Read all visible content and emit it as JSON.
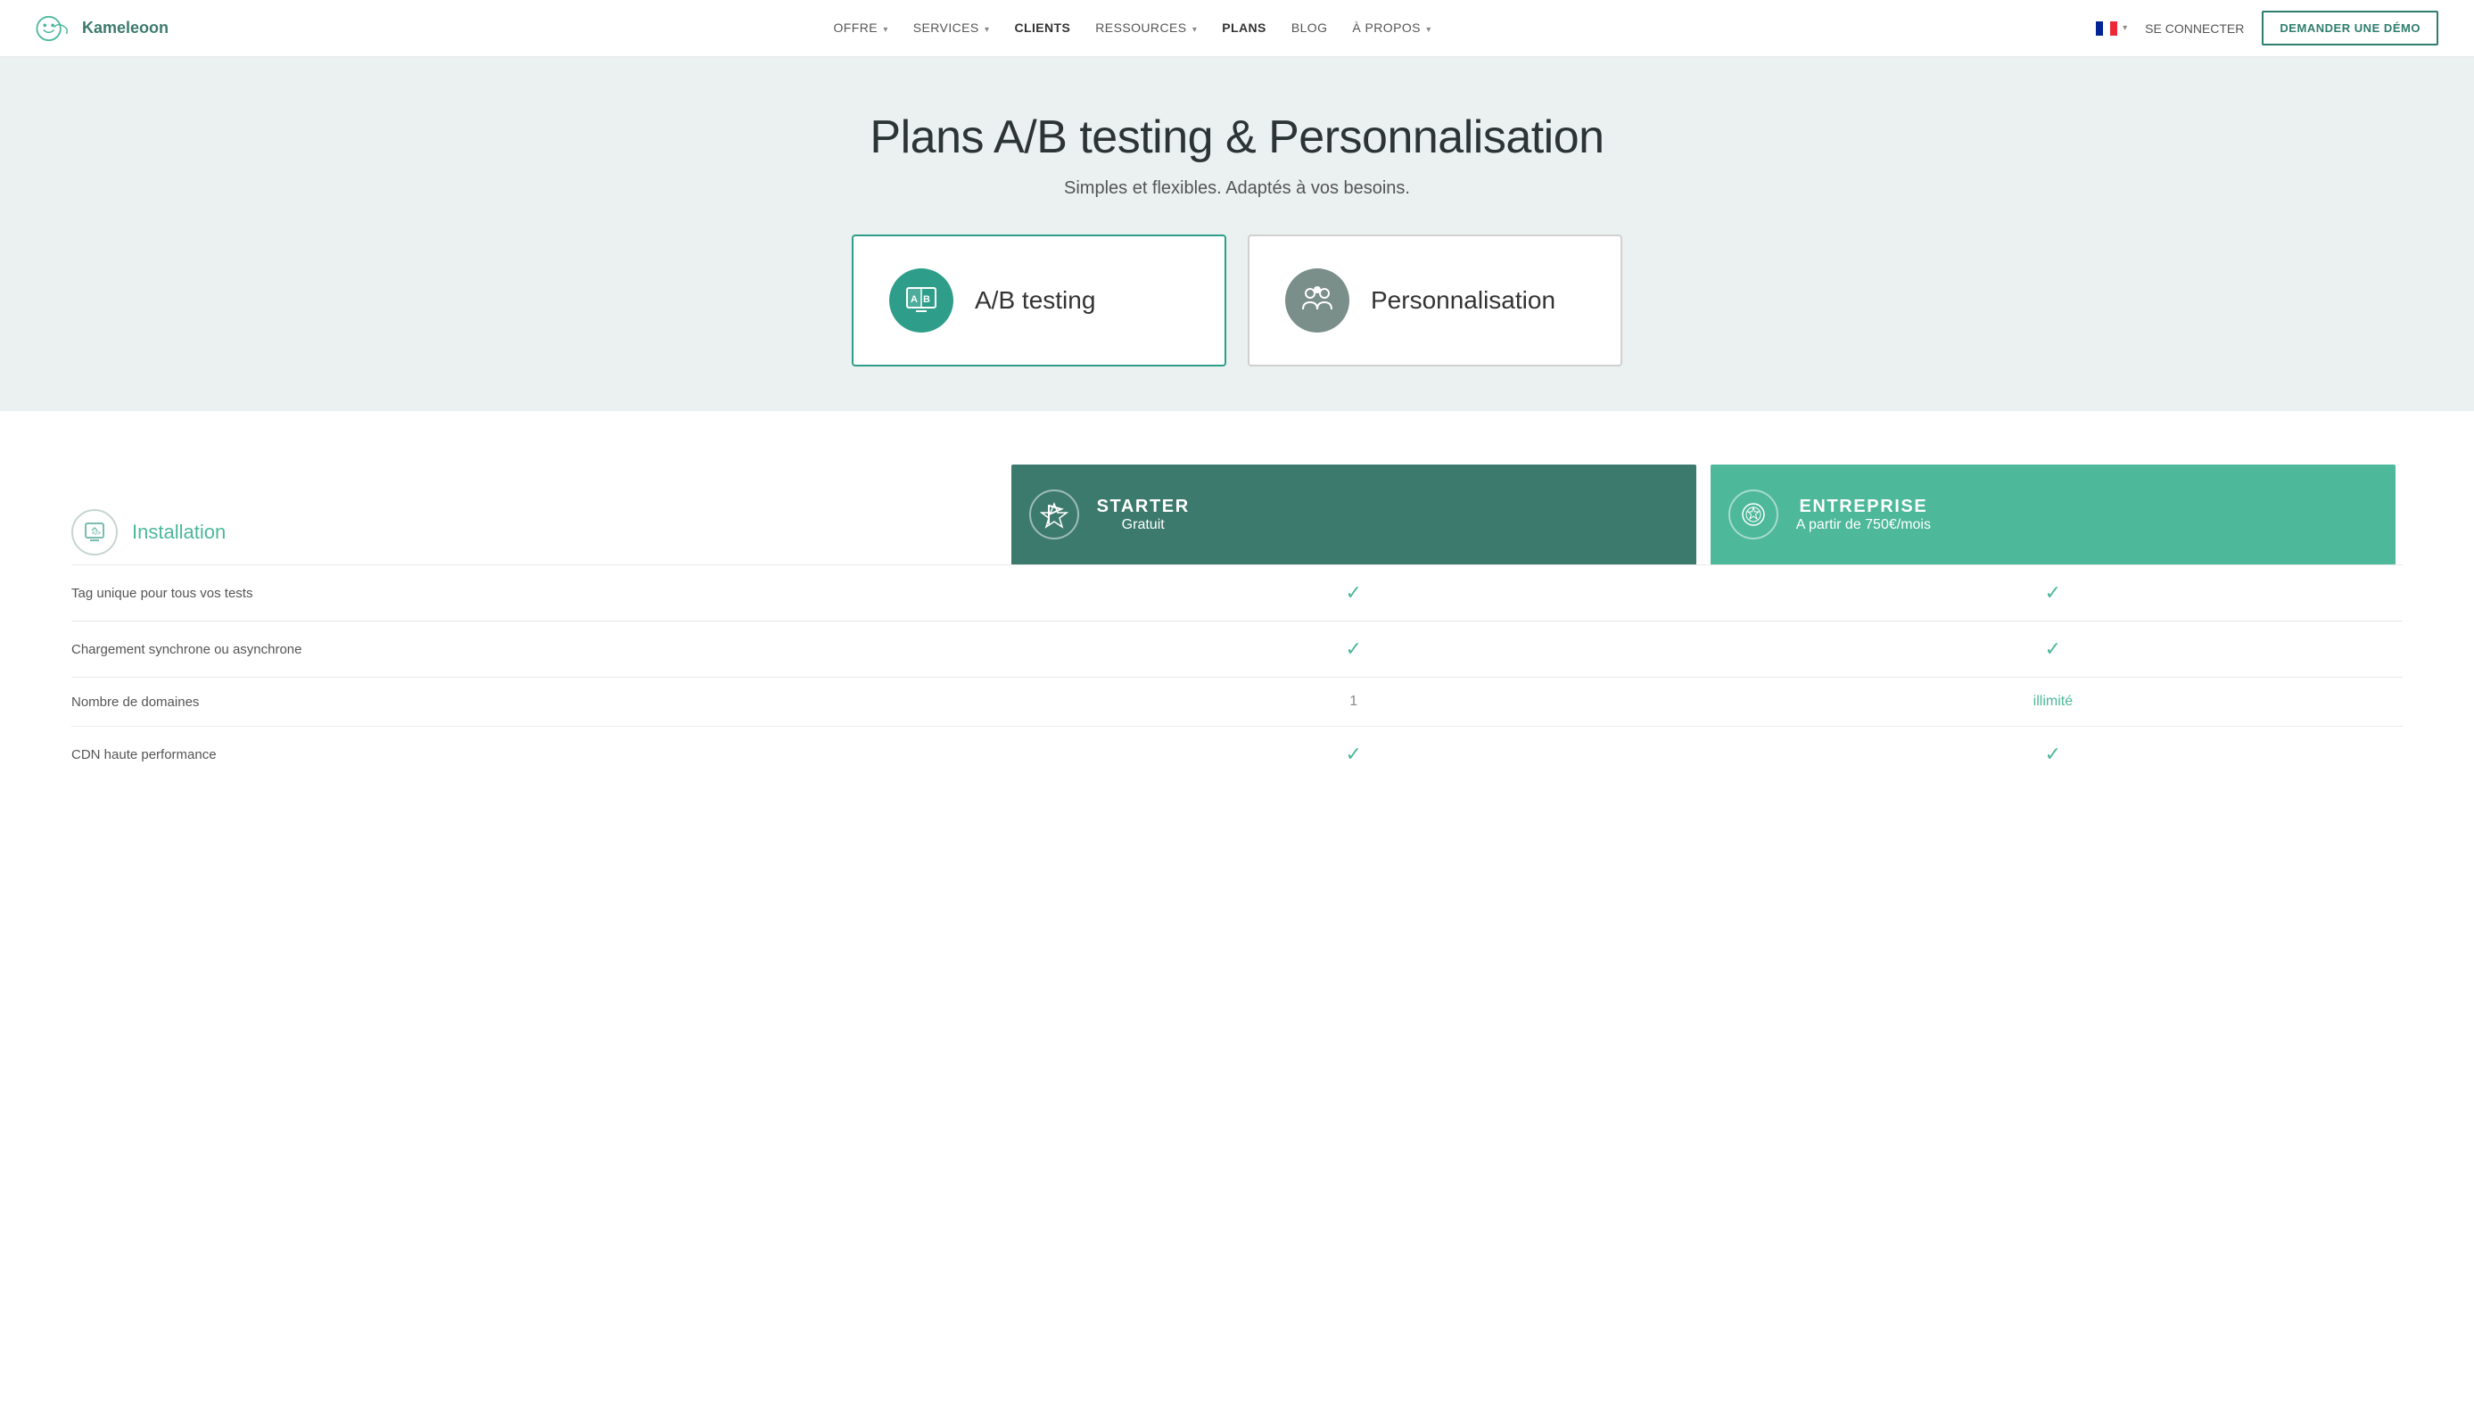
{
  "brand": {
    "name": "Kameleoon"
  },
  "nav": {
    "links": [
      {
        "label": "OFFRE",
        "has_dropdown": true
      },
      {
        "label": "SERVICES",
        "has_dropdown": true
      },
      {
        "label": "CLIENTS",
        "has_dropdown": false
      },
      {
        "label": "RESSOURCES",
        "has_dropdown": true
      },
      {
        "label": "PLANS",
        "has_dropdown": false
      },
      {
        "label": "BLOG",
        "has_dropdown": false
      },
      {
        "label": "À PROPOS",
        "has_dropdown": true
      }
    ],
    "lang_label": "FR",
    "login_label": "SE CONNECTER",
    "demo_label": "DEMANDER UNE DÉMO"
  },
  "hero": {
    "title": "Plans A/B testing & Personnalisation",
    "subtitle": "Simples et flexibles. Adaptés à vos besoins.",
    "cards": [
      {
        "label": "A/B testing",
        "icon_type": "ab",
        "active": true
      },
      {
        "label": "Personnalisation",
        "icon_type": "people",
        "active": false
      }
    ]
  },
  "pricing": {
    "section_icon_label": "Installation",
    "plans": [
      {
        "name": "STARTER",
        "price": "Gratuit",
        "type": "starter",
        "icon_type": "flag"
      },
      {
        "name": "ENTREPRISE",
        "price": "A partir de 750€/mois",
        "type": "entreprise",
        "icon_type": "badge"
      }
    ],
    "features": [
      {
        "label": "Tag unique pour tous vos tests",
        "starter": "check",
        "entreprise": "check"
      },
      {
        "label": "Chargement synchrone ou asynchrone",
        "starter": "check",
        "entreprise": "check"
      },
      {
        "label": "Nombre de domaines",
        "starter": "1",
        "starter_color": "grey",
        "entreprise": "illimité",
        "entreprise_color": "green"
      },
      {
        "label": "CDN haute performance",
        "starter": "check",
        "entreprise": "check"
      }
    ]
  }
}
